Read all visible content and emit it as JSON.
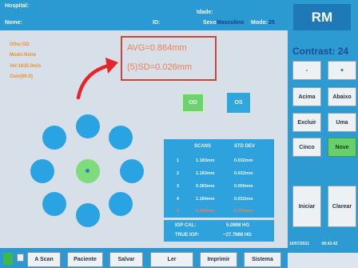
{
  "header": {
    "hospital_label": "Hospital:",
    "name_label": "Nome:",
    "id_label": "ID:",
    "age_label": "Idade:",
    "sex_label": "Sexo:",
    "sex_value": "Masculino",
    "mode_label": "Modo:",
    "mode_value": "25"
  },
  "info": {
    "eye": "Olho:OD",
    "mode": "Modo:None",
    "vel": "Vel:1635.0m/s",
    "gain": "Gain(60.0)"
  },
  "measurement": {
    "avg": "AVG=0.864mm",
    "sd": "(5)SD=0.026mm"
  },
  "eyes": {
    "od": "OD",
    "os": "OS"
  },
  "table": {
    "col_scans": "SCANS",
    "col_std": "STD DEV",
    "rows": [
      {
        "n": "1",
        "scan": "1.183mm",
        "std": "0.032mm",
        "red": false
      },
      {
        "n": "2",
        "scan": "1.183mm",
        "std": "0.032mm",
        "red": false
      },
      {
        "n": "3",
        "scan": "0.383mm",
        "std": "0.000mm",
        "red": false
      },
      {
        "n": "4",
        "scan": "1.184mm",
        "std": "0.032mm",
        "red": false
      },
      {
        "n": "5",
        "scan": "0.383mm",
        "std": "0.029mm",
        "red": true
      }
    ]
  },
  "iop": {
    "cal_label": "IOP CAL:",
    "cal_value": "5.0MM HG",
    "true_label": "TRUE IOP:",
    "true_value": "~27.7MM HG"
  },
  "right": {
    "logo": "RM",
    "contrast_label": "Contrast:",
    "contrast_value": "24",
    "minus": "-",
    "plus": "+",
    "up": "Acima",
    "down": "Abaixo",
    "delete": "Excluir",
    "one": "Uma",
    "five": "Cinco",
    "nine": "Nove",
    "start": "Iniciar",
    "clear": "Clarear",
    "date": "10/07/2021",
    "time": "08:43:42"
  },
  "bottom": {
    "a_scan": "A Scan",
    "patient": "Paciente",
    "save": "Salvar",
    "read": "Ler",
    "print": "Imprimir",
    "system": "Sistema"
  },
  "colors": {
    "accent_blue": "#2c9ad2",
    "measurement_red": "#c8453a",
    "active_green": "#67d06b"
  }
}
